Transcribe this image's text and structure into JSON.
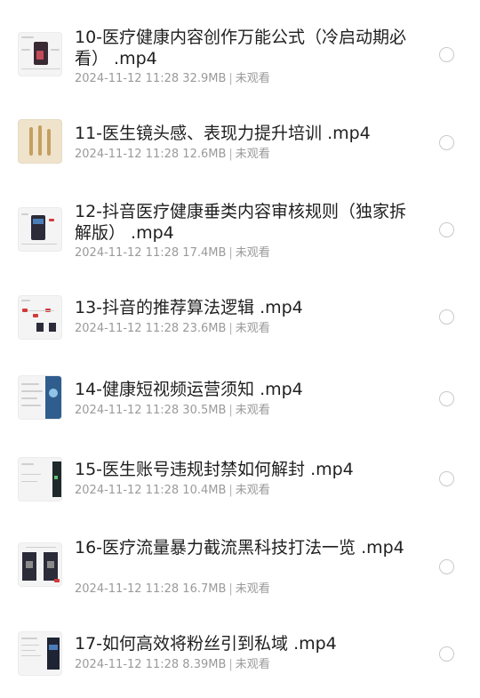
{
  "items": [
    {
      "title": "10-医疗健康内容创作万能公式（冷启动期必看） .mp4",
      "date": "2024-11-12 11:28",
      "size": "32.9MB",
      "status": "未观看",
      "thumbnail_icon": "video-thumbnail-icon"
    },
    {
      "title": "11-医生镜头感、表现力提升培训 .mp4",
      "date": "2024-11-12 11:28",
      "size": "12.6MB",
      "status": "未观看",
      "thumbnail_icon": "video-thumbnail-icon"
    },
    {
      "title": "12-抖音医疗健康垂类内容审核规则（独家拆解版） .mp4",
      "date": "2024-11-12 11:28",
      "size": "17.4MB",
      "status": "未观看",
      "thumbnail_icon": "video-thumbnail-icon"
    },
    {
      "title": "13-抖音的推荐算法逻辑 .mp4",
      "date": "2024-11-12 11:28",
      "size": "23.6MB",
      "status": "未观看",
      "thumbnail_icon": "video-thumbnail-icon"
    },
    {
      "title": "14-健康短视频运营须知 .mp4",
      "date": "2024-11-12 11:28",
      "size": "30.5MB",
      "status": "未观看",
      "thumbnail_icon": "video-thumbnail-icon"
    },
    {
      "title": "15-医生账号违规封禁如何解封 .mp4",
      "date": "2024-11-12 11:28",
      "size": "10.4MB",
      "status": "未观看",
      "thumbnail_icon": "video-thumbnail-icon"
    },
    {
      "title": "16-医疗流量暴力截流黑科技打法一览 .mp4",
      "date": "2024-11-12 11:28",
      "size": "16.7MB",
      "status": "未观看",
      "thumbnail_icon": "video-thumbnail-icon"
    },
    {
      "title": "17-如何高效将粉丝引到私域 .mp4",
      "date": "2024-11-12 11:28",
      "size": "8.39MB",
      "status": "未观看",
      "thumbnail_icon": "video-thumbnail-icon"
    }
  ],
  "separator": "|",
  "colors": {
    "title": "#1f1f1f",
    "meta": "#9a9a9a",
    "radio_border": "#c9c9c9",
    "background": "#ffffff"
  }
}
